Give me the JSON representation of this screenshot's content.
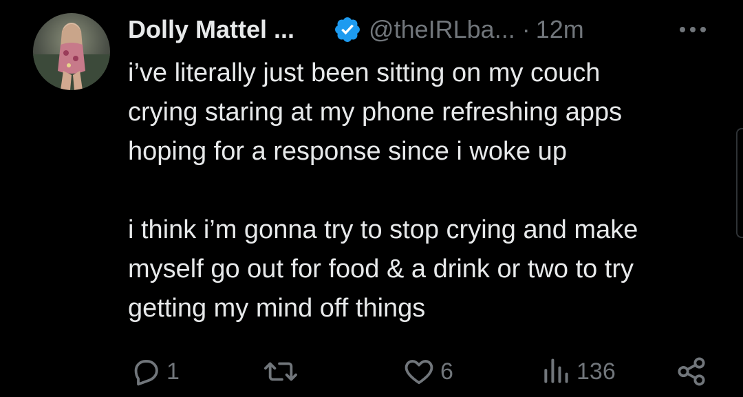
{
  "tweet": {
    "author": {
      "display_name": "Dolly Mattel ...",
      "handle": "@theIRLba...",
      "verified": true,
      "avatar_icon": "avatar-photo"
    },
    "separator": "·",
    "timestamp": "12m",
    "more_icon": "more-horizontal-icon",
    "text": [
      "i’ve literally just been sitting on my couch\ncrying staring at my phone refreshing apps\nhoping for a response since i woke up",
      "i think i’m gonna try to stop crying and make\nmyself go out for food & a drink or two to try\ngetting my mind off things"
    ],
    "actions": {
      "reply": {
        "icon": "reply-icon",
        "count": "1"
      },
      "retweet": {
        "icon": "retweet-icon",
        "count": ""
      },
      "like": {
        "icon": "heart-icon",
        "count": "6"
      },
      "views": {
        "icon": "views-icon",
        "count": "136"
      },
      "share": {
        "icon": "share-icon"
      }
    }
  },
  "colors": {
    "background": "#000000",
    "text_primary": "#e7e9ea",
    "text_secondary": "#71767b",
    "verified_badge": "#1d9bf0"
  }
}
